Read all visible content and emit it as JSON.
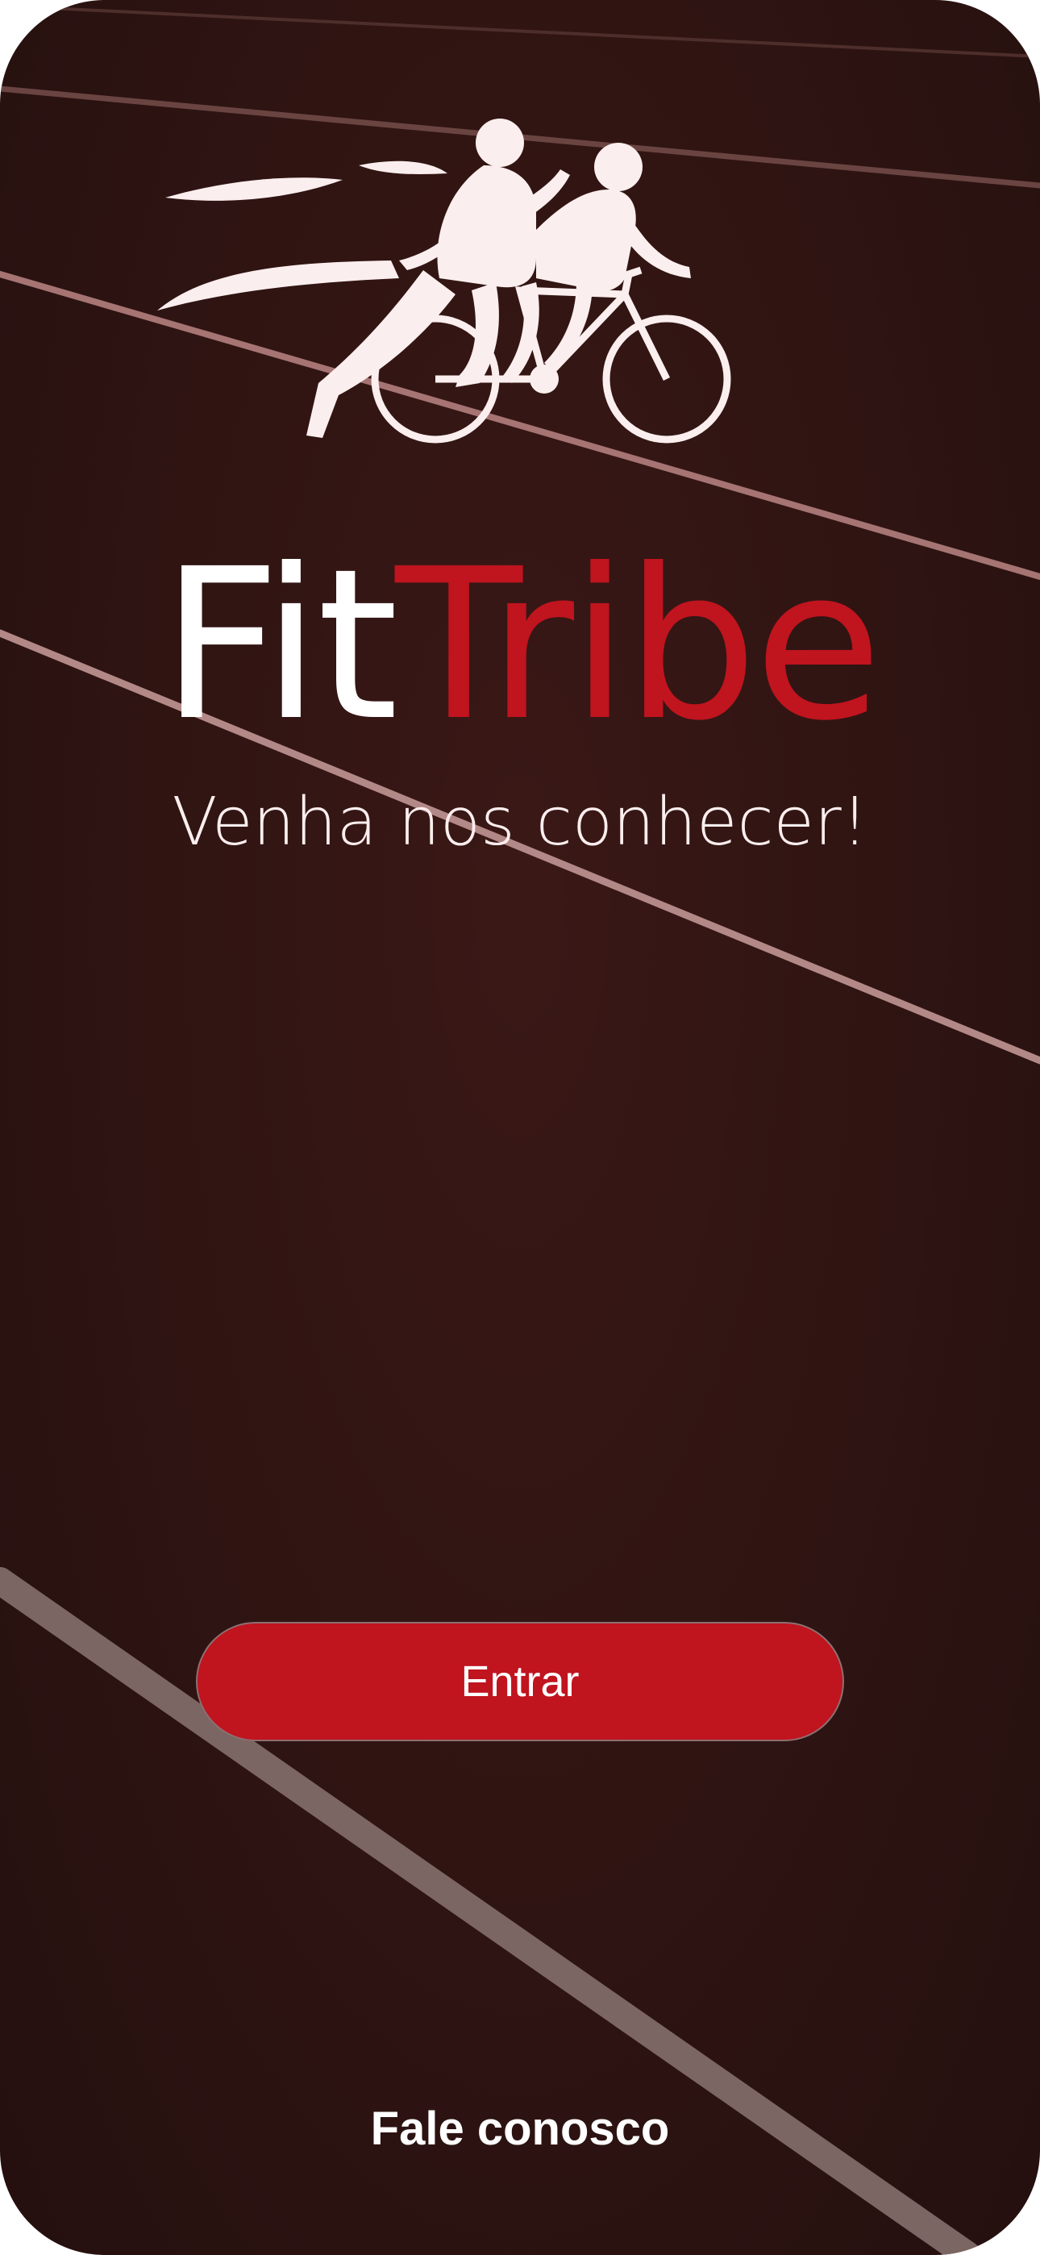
{
  "app": {
    "brand_part_a": "Fit",
    "brand_part_b": "Tribe",
    "tagline": "Venha nos conhecer!"
  },
  "logo": {
    "icon": "runner-and-cyclist-icon"
  },
  "actions": {
    "enter_label": "Entrar",
    "contact_label": "Fale conosco"
  },
  "colors": {
    "background": "#2e1412",
    "accent": "#c0141f",
    "text_light": "#ffffff"
  }
}
